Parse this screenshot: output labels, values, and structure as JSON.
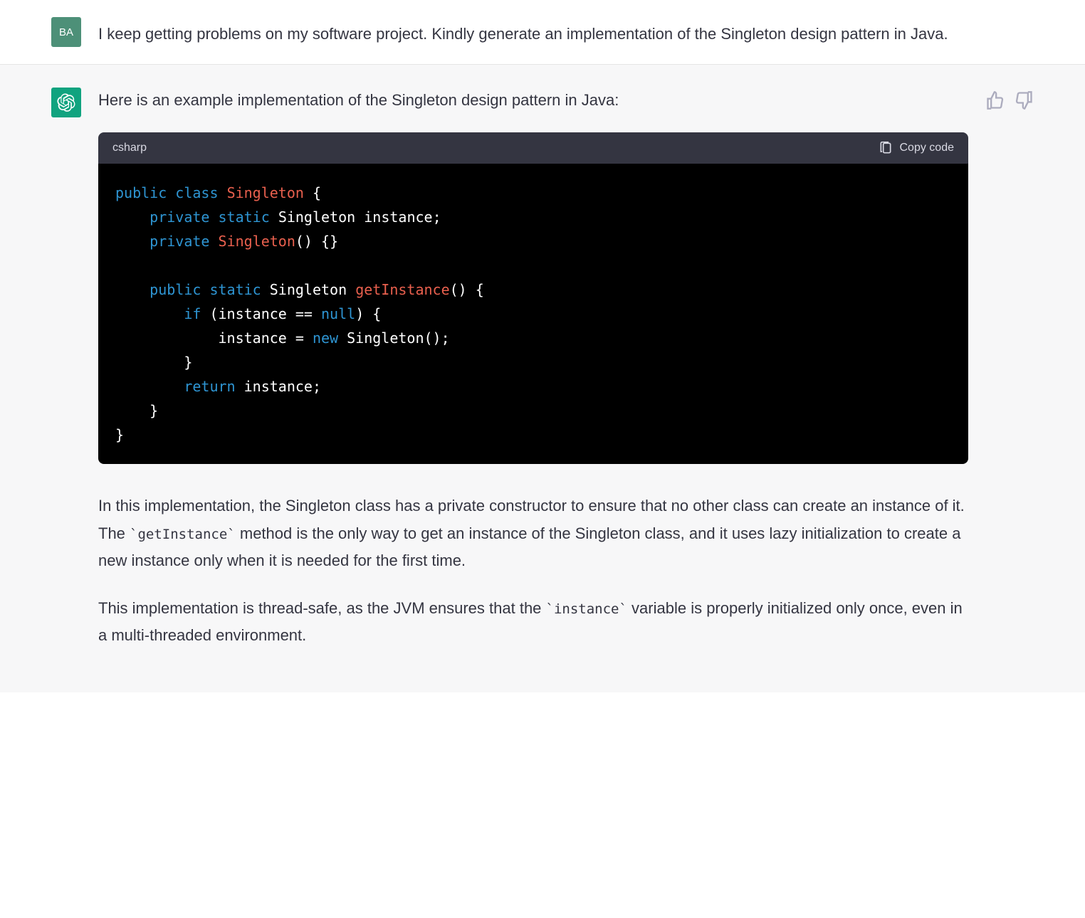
{
  "user": {
    "avatar_initials": "BA",
    "message": "I keep getting problems on my software project. Kindly generate an implementation of the Singleton design pattern in Java."
  },
  "assistant": {
    "intro": "Here is an example implementation of the Singleton design pattern in Java:",
    "code": {
      "language_label": "csharp",
      "copy_label": "Copy code",
      "tokens": {
        "public": "public",
        "class": "class",
        "singleton": "Singleton",
        "obrace": "{",
        "private": "private",
        "static": "static",
        "instance": "instance",
        "semi": ";",
        "ctor": "Singleton",
        "pp": "()",
        "cbrace_empty": "{}",
        "get_instance": "getInstance",
        "paren_ob": "() {",
        "if": "if",
        "lp": "(instance ==",
        "null": "null",
        "rp_ob": ") {",
        "assign": "instance =",
        "new": "new",
        "ctor_call": "Singleton();",
        "cbrace": "}",
        "return": "return",
        "ret_val": "instance;"
      }
    },
    "explain1_pre": "In this implementation, the Singleton class has a private constructor to ensure that no other class can create an instance of it. The ",
    "explain1_code": "`getInstance`",
    "explain1_post": " method is the only way to get an instance of the Singleton class, and it uses lazy initialization to create a new instance only when it is needed for the first time.",
    "explain2_pre": "This implementation is thread-safe, as the JVM ensures that the ",
    "explain2_code": "`instance`",
    "explain2_post": " variable is properly initialized only once, even in a multi-threaded environment."
  }
}
